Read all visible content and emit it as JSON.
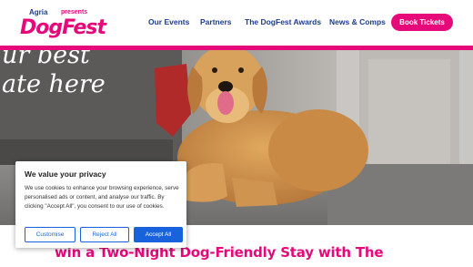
{
  "logo": {
    "sponsor": "Agria",
    "presents": "presents",
    "brand": "DogFest"
  },
  "nav": {
    "items": [
      "Our Events",
      "Partners",
      "The DogFest Awards",
      "News & Comps"
    ],
    "cta": "Book Tickets"
  },
  "hero": {
    "line1": "ur best",
    "line2": "ate here"
  },
  "promo": {
    "headline": "win a Two-Night Dog-Friendly Stay with The"
  },
  "cookie": {
    "title": "We value your privacy",
    "body": "We use cookies to enhance your browsing experience, serve personalised ads or content, and analyse our traffic. By clicking \"Accept All\", you consent to our use of cookies.",
    "customise": "Customise",
    "reject": "Reject All",
    "accept": "Accept All"
  },
  "colors": {
    "brand_pink": "#e6097a",
    "nav_blue": "#1d3c8f",
    "cookie_blue": "#1863dc"
  }
}
